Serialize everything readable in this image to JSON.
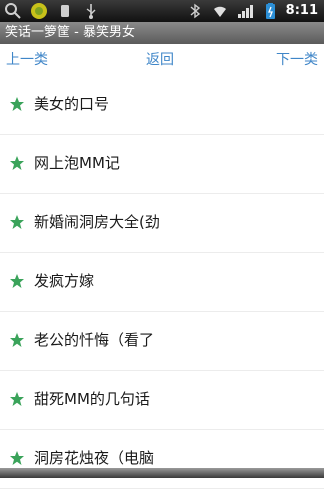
{
  "status_bar": {
    "time": "8:11",
    "icons": [
      "search-icon",
      "app-notification-icon",
      "vibrate-icon",
      "usb-icon",
      "bluetooth-icon",
      "wifi-icon",
      "signal-icon",
      "battery-icon"
    ]
  },
  "title_bar": {
    "title": "笑话一箩筐 - 暴笑男女"
  },
  "nav": {
    "prev_label": "上一类",
    "back_label": "返回",
    "next_label": "下一类"
  },
  "list": {
    "items": [
      {
        "label": "美女的口号"
      },
      {
        "label": "网上泡MM记"
      },
      {
        "label": "新婚闹洞房大全(劲"
      },
      {
        "label": "发疯方嫁"
      },
      {
        "label": "老公的忏悔（看了"
      },
      {
        "label": "甜死MM的几句话"
      },
      {
        "label": "洞房花烛夜（电脑"
      }
    ]
  },
  "colors": {
    "link": "#3f86c8",
    "star": "#3aa35a",
    "statusbar": "#1a1a1a",
    "titlebar": "#6e6e6e"
  }
}
